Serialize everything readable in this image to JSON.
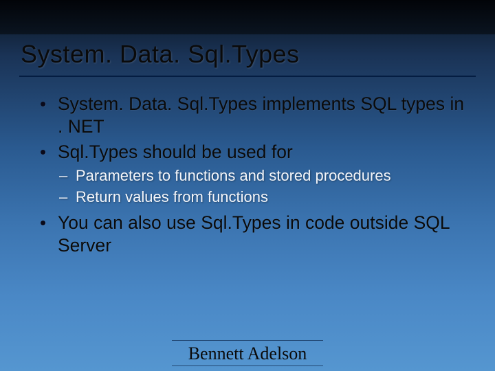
{
  "title": "System. Data. Sql.Types",
  "bullets": [
    {
      "text": "System. Data. Sql.Types implements SQL types in . NET"
    },
    {
      "text": "Sql.Types should be used for",
      "sub": [
        "Parameters to functions and stored procedures",
        "Return values from functions"
      ]
    },
    {
      "text": "You can also use Sql.Types in code outside SQL Server"
    }
  ],
  "footer": "Bennett Adelson"
}
